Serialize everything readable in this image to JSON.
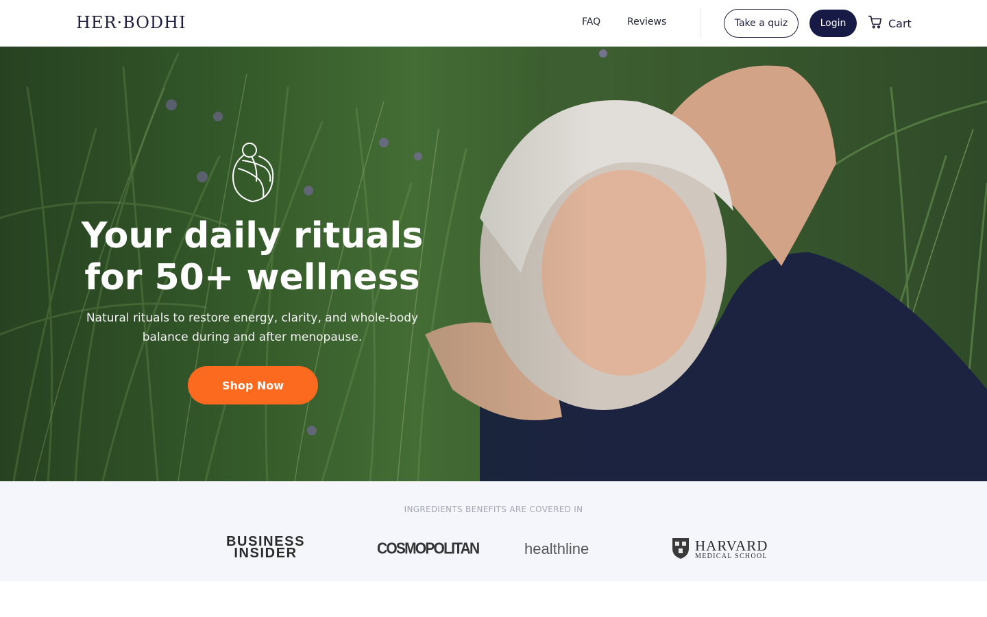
{
  "header": {
    "logo_text": "HER·BODHI",
    "nav": {
      "faq": "FAQ",
      "reviews": "Reviews"
    },
    "quiz_button": "Take a quiz",
    "login_button": "Login",
    "cart_label": "Cart",
    "cart_icon": "cart-icon"
  },
  "hero": {
    "icon": "embrace-outline-icon",
    "title": "Your daily rituals for 50+ wellness",
    "subtitle": "Natural rituals to restore energy, clarity, and whole-body balance during and after menopause.",
    "cta_label": "Shop Now"
  },
  "press": {
    "label": "INGREDIENTS BENEFITS ARE COVERED IN",
    "logos": {
      "business_insider_1": "BUSINESS",
      "business_insider_2": "INSIDER",
      "cosmopolitan": "COSMOPOLITAN",
      "healthline": "healthline",
      "harvard_1": "HARVARD",
      "harvard_2": "MEDICAL SCHOOL"
    }
  },
  "colors": {
    "brand_navy": "#171a45",
    "cta_orange": "#fb6a1f",
    "press_bg": "#f5f6fb"
  }
}
